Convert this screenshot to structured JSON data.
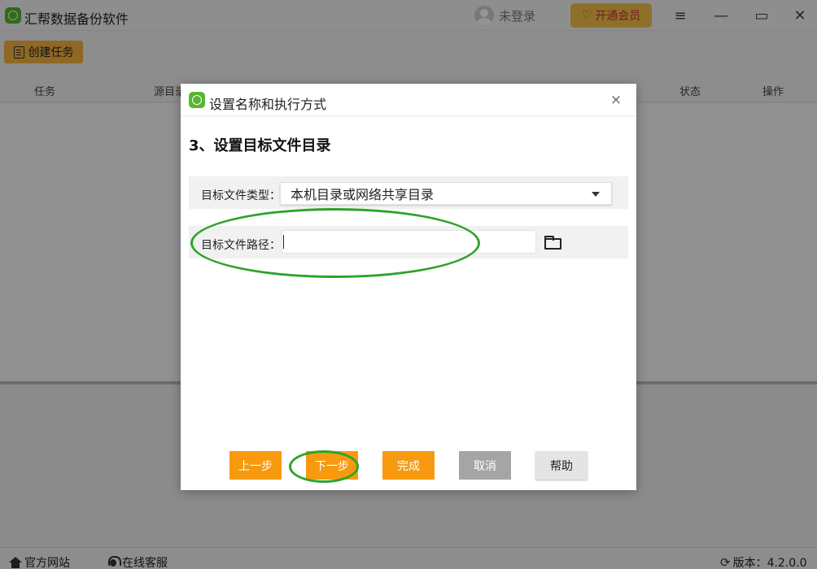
{
  "app": {
    "title": "汇帮数据备份软件",
    "user_status": "未登录",
    "vip_label": "开通会员",
    "create_task_label": "创建任务"
  },
  "table": {
    "headers": [
      "任务",
      "源目录",
      "状态",
      "操作"
    ]
  },
  "statusbar": {
    "website": "官方网站",
    "support": "在线客服",
    "version": "版本：4.2.0.0"
  },
  "dialog": {
    "title": "设置名称和执行方式",
    "close_glyph": "×",
    "step_heading": "3、设置目标文件目录",
    "target_type_label": "目标文件类型：",
    "target_type_value": "本机目录或网络共享目录",
    "target_path_label": "目标文件路径：",
    "target_path_value": "",
    "buttons": {
      "prev": "上一步",
      "next": "下一步",
      "finish": "完成",
      "cancel": "取消",
      "help": "帮助"
    }
  },
  "annotation": {
    "color": "#2ea32a"
  },
  "colors": {
    "accent_orange": "#f79a10",
    "vip_gold": "#f4c14a",
    "brand_green": "#57b52f"
  },
  "icons": [
    "app-logo-icon",
    "user-avatar-icon",
    "vip-diamond-icon",
    "menu-icon",
    "minimize-icon",
    "maximize-icon",
    "close-icon",
    "document-icon",
    "folder-open-icon",
    "dropdown-caret-icon",
    "home-icon",
    "headset-icon",
    "refresh-icon"
  ]
}
